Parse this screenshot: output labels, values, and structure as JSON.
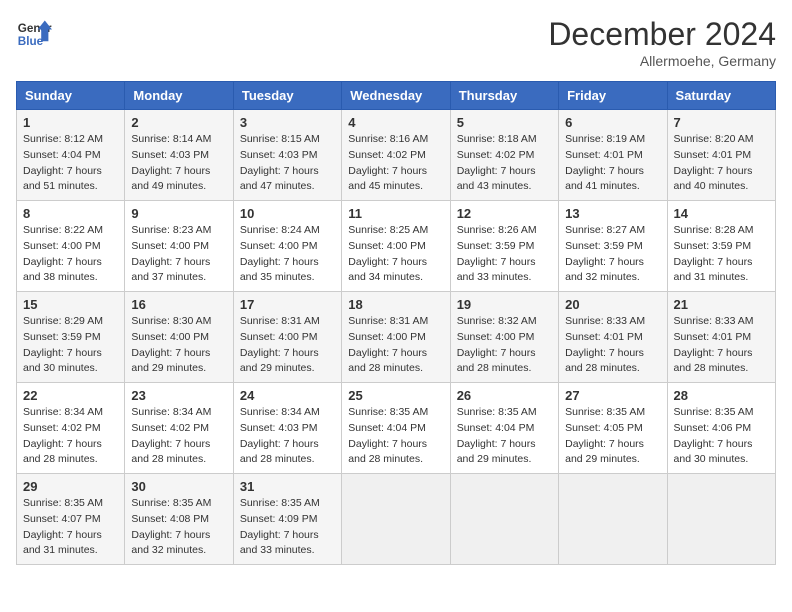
{
  "header": {
    "logo_line1": "General",
    "logo_line2": "Blue",
    "month": "December 2024",
    "location": "Allermoehe, Germany"
  },
  "weekdays": [
    "Sunday",
    "Monday",
    "Tuesday",
    "Wednesday",
    "Thursday",
    "Friday",
    "Saturday"
  ],
  "weeks": [
    [
      {
        "day": 1,
        "sunrise": "8:12 AM",
        "sunset": "4:04 PM",
        "daylight": "7 hours and 51 minutes."
      },
      {
        "day": 2,
        "sunrise": "8:14 AM",
        "sunset": "4:03 PM",
        "daylight": "7 hours and 49 minutes."
      },
      {
        "day": 3,
        "sunrise": "8:15 AM",
        "sunset": "4:03 PM",
        "daylight": "7 hours and 47 minutes."
      },
      {
        "day": 4,
        "sunrise": "8:16 AM",
        "sunset": "4:02 PM",
        "daylight": "7 hours and 45 minutes."
      },
      {
        "day": 5,
        "sunrise": "8:18 AM",
        "sunset": "4:02 PM",
        "daylight": "7 hours and 43 minutes."
      },
      {
        "day": 6,
        "sunrise": "8:19 AM",
        "sunset": "4:01 PM",
        "daylight": "7 hours and 41 minutes."
      },
      {
        "day": 7,
        "sunrise": "8:20 AM",
        "sunset": "4:01 PM",
        "daylight": "7 hours and 40 minutes."
      }
    ],
    [
      {
        "day": 8,
        "sunrise": "8:22 AM",
        "sunset": "4:00 PM",
        "daylight": "7 hours and 38 minutes."
      },
      {
        "day": 9,
        "sunrise": "8:23 AM",
        "sunset": "4:00 PM",
        "daylight": "7 hours and 37 minutes."
      },
      {
        "day": 10,
        "sunrise": "8:24 AM",
        "sunset": "4:00 PM",
        "daylight": "7 hours and 35 minutes."
      },
      {
        "day": 11,
        "sunrise": "8:25 AM",
        "sunset": "4:00 PM",
        "daylight": "7 hours and 34 minutes."
      },
      {
        "day": 12,
        "sunrise": "8:26 AM",
        "sunset": "3:59 PM",
        "daylight": "7 hours and 33 minutes."
      },
      {
        "day": 13,
        "sunrise": "8:27 AM",
        "sunset": "3:59 PM",
        "daylight": "7 hours and 32 minutes."
      },
      {
        "day": 14,
        "sunrise": "8:28 AM",
        "sunset": "3:59 PM",
        "daylight": "7 hours and 31 minutes."
      }
    ],
    [
      {
        "day": 15,
        "sunrise": "8:29 AM",
        "sunset": "3:59 PM",
        "daylight": "7 hours and 30 minutes."
      },
      {
        "day": 16,
        "sunrise": "8:30 AM",
        "sunset": "4:00 PM",
        "daylight": "7 hours and 29 minutes."
      },
      {
        "day": 17,
        "sunrise": "8:31 AM",
        "sunset": "4:00 PM",
        "daylight": "7 hours and 29 minutes."
      },
      {
        "day": 18,
        "sunrise": "8:31 AM",
        "sunset": "4:00 PM",
        "daylight": "7 hours and 28 minutes."
      },
      {
        "day": 19,
        "sunrise": "8:32 AM",
        "sunset": "4:00 PM",
        "daylight": "7 hours and 28 minutes."
      },
      {
        "day": 20,
        "sunrise": "8:33 AM",
        "sunset": "4:01 PM",
        "daylight": "7 hours and 28 minutes."
      },
      {
        "day": 21,
        "sunrise": "8:33 AM",
        "sunset": "4:01 PM",
        "daylight": "7 hours and 28 minutes."
      }
    ],
    [
      {
        "day": 22,
        "sunrise": "8:34 AM",
        "sunset": "4:02 PM",
        "daylight": "7 hours and 28 minutes."
      },
      {
        "day": 23,
        "sunrise": "8:34 AM",
        "sunset": "4:02 PM",
        "daylight": "7 hours and 28 minutes."
      },
      {
        "day": 24,
        "sunrise": "8:34 AM",
        "sunset": "4:03 PM",
        "daylight": "7 hours and 28 minutes."
      },
      {
        "day": 25,
        "sunrise": "8:35 AM",
        "sunset": "4:04 PM",
        "daylight": "7 hours and 28 minutes."
      },
      {
        "day": 26,
        "sunrise": "8:35 AM",
        "sunset": "4:04 PM",
        "daylight": "7 hours and 29 minutes."
      },
      {
        "day": 27,
        "sunrise": "8:35 AM",
        "sunset": "4:05 PM",
        "daylight": "7 hours and 29 minutes."
      },
      {
        "day": 28,
        "sunrise": "8:35 AM",
        "sunset": "4:06 PM",
        "daylight": "7 hours and 30 minutes."
      }
    ],
    [
      {
        "day": 29,
        "sunrise": "8:35 AM",
        "sunset": "4:07 PM",
        "daylight": "7 hours and 31 minutes."
      },
      {
        "day": 30,
        "sunrise": "8:35 AM",
        "sunset": "4:08 PM",
        "daylight": "7 hours and 32 minutes."
      },
      {
        "day": 31,
        "sunrise": "8:35 AM",
        "sunset": "4:09 PM",
        "daylight": "7 hours and 33 minutes."
      },
      null,
      null,
      null,
      null
    ]
  ]
}
